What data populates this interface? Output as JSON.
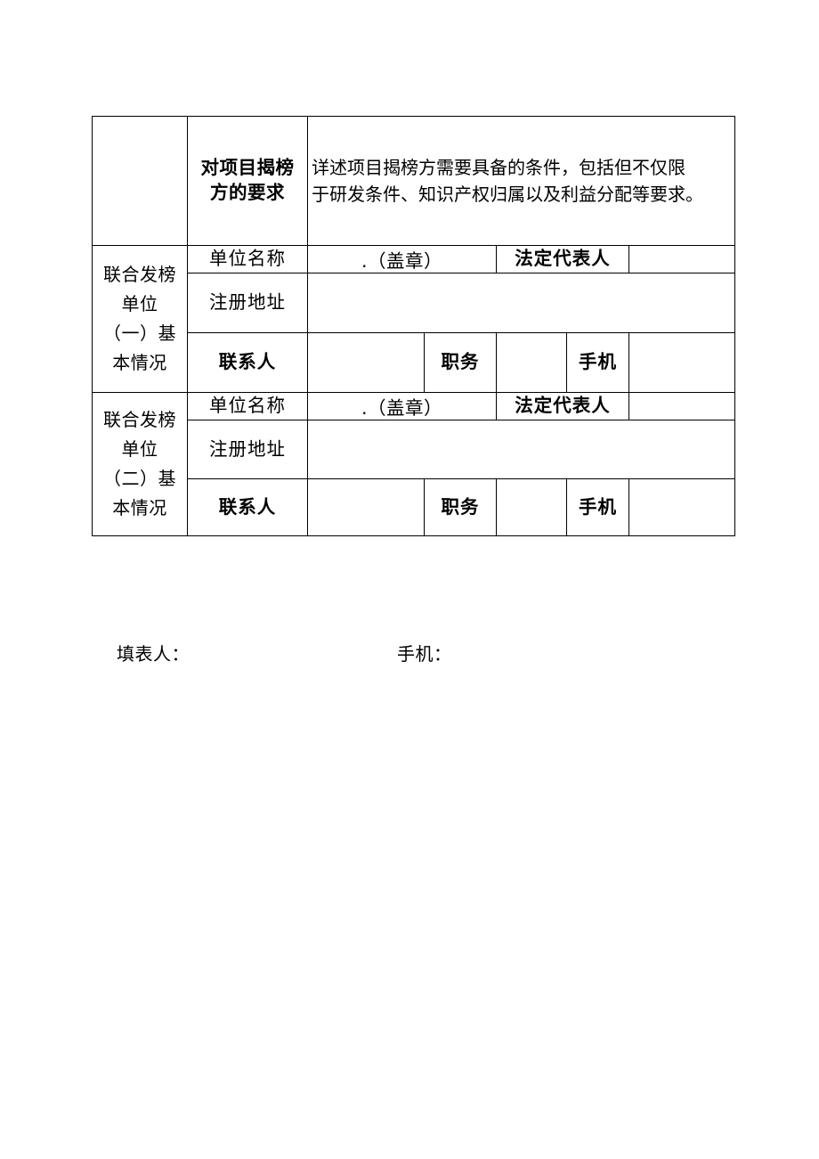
{
  "document": {
    "type": "form-table",
    "language": "zh-CN"
  },
  "table": {
    "requirements_row": {
      "left_cell": "",
      "label": "对项目揭榜\n方的要求",
      "label_lines": [
        "对项目揭榜",
        "方的要求"
      ],
      "description_lines": [
        "详述项目揭榜方需要具备的条件，包括但不仅限",
        "于研发条件、知识产权归属以及利益分配等要求。"
      ],
      "description_full": "详述项目揭榜方需要具备的条件，包括但不仅限于研发条件、知识产权归属以及利益分配等要求。"
    },
    "blocks": [
      {
        "side_label": "联合发榜单位（一）基本情况",
        "side_label_lines": [
          "联合发榜",
          "单位",
          "（一）基",
          "本情况"
        ],
        "rows": [
          {
            "field_label": "单位名称",
            "field_value": ".（盖章）",
            "secondary_label": "法定代表人",
            "secondary_value": ""
          },
          {
            "field_label": "注册地址",
            "field_value": ""
          },
          {
            "field_label": "联系人",
            "field_value": "",
            "label_2": "职务",
            "value_2": "",
            "label_3": "手机",
            "value_3": ""
          }
        ]
      },
      {
        "side_label": "联合发榜单位（二）基本情况",
        "side_label_lines": [
          "联合发榜",
          "单位",
          "（二）基",
          "本情况"
        ],
        "rows": [
          {
            "field_label": "单位名称",
            "field_value": ".（盖章）",
            "secondary_label": "法定代表人",
            "secondary_value": ""
          },
          {
            "field_label": "注册地址",
            "field_value": ""
          },
          {
            "field_label": "联系人",
            "field_value": "",
            "label_2": "职务",
            "value_2": "",
            "label_3": "手机",
            "value_3": ""
          }
        ]
      }
    ]
  },
  "footer": {
    "filler_label": "填表人：",
    "phone_label": "手机："
  },
  "colors": {
    "border": "#000000",
    "text": "#000000",
    "background": "#ffffff"
  }
}
